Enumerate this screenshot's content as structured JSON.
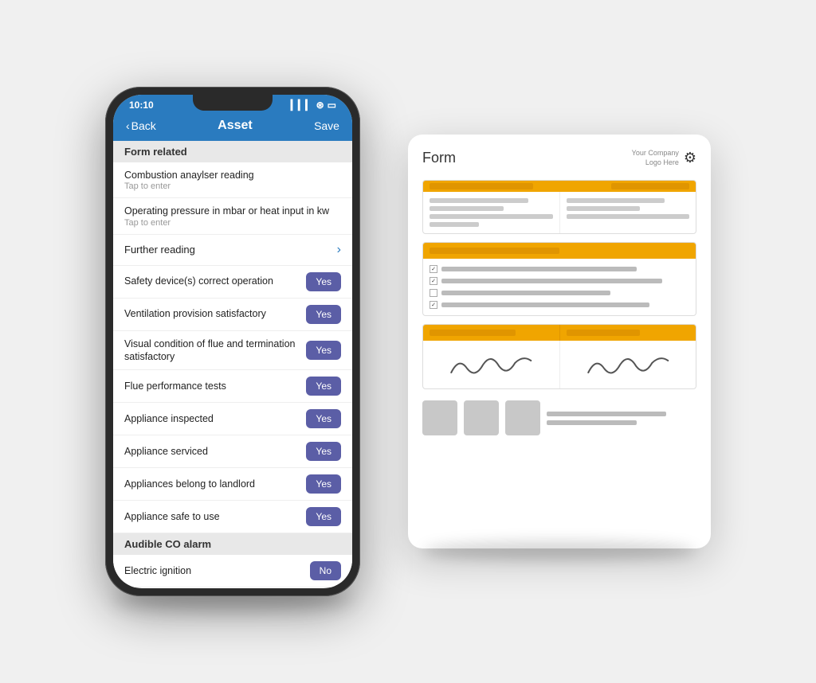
{
  "phone": {
    "status": {
      "time": "10:10",
      "signal": "▎▎▎",
      "wifi": "WiFi",
      "battery": "Battery"
    },
    "nav": {
      "back": "Back",
      "title": "Asset",
      "save": "Save"
    },
    "sections": [
      {
        "id": "form-related",
        "header": "Form related",
        "items": [
          {
            "id": "combustion",
            "label": "Combustion anaylser reading",
            "sub": "Tap to enter",
            "btn": null
          },
          {
            "id": "operating-pressure",
            "label": "Operating pressure in mbar or heat input in kw",
            "sub": "Tap to enter",
            "btn": null
          },
          {
            "id": "further-reading",
            "label": "Further reading",
            "btn": "chevron",
            "type": "nav"
          },
          {
            "id": "safety-devices",
            "label": "Safety device(s) correct operation",
            "btn": "Yes"
          },
          {
            "id": "ventilation",
            "label": "Ventilation provision satisfactory",
            "btn": "Yes"
          },
          {
            "id": "visual-condition",
            "label": "Visual condition of flue and termination satisfactory",
            "btn": "Yes"
          },
          {
            "id": "flue-performance",
            "label": "Flue performance tests",
            "btn": "Yes"
          },
          {
            "id": "appliance-inspected",
            "label": "Appliance inspected",
            "btn": "Yes"
          },
          {
            "id": "appliance-serviced",
            "label": "Appliance serviced",
            "btn": "Yes"
          },
          {
            "id": "appliances-landlord",
            "label": "Appliances belong to landlord",
            "btn": "Yes"
          },
          {
            "id": "appliance-safe",
            "label": "Appliance safe to use",
            "btn": "Yes"
          }
        ]
      },
      {
        "id": "audible-co",
        "header": "Audible CO alarm",
        "items": [
          {
            "id": "electric-ignition",
            "label": "Electric ignition",
            "btn": "No"
          }
        ]
      }
    ]
  },
  "form_doc": {
    "title": "Form",
    "company_line1": "Your Company",
    "company_line2": "Logo Here",
    "wrench_symbol": "🔧"
  },
  "buttons": {
    "yes_label": "Yes",
    "no_label": "No",
    "back_label": "< Back",
    "chevron": "›"
  }
}
